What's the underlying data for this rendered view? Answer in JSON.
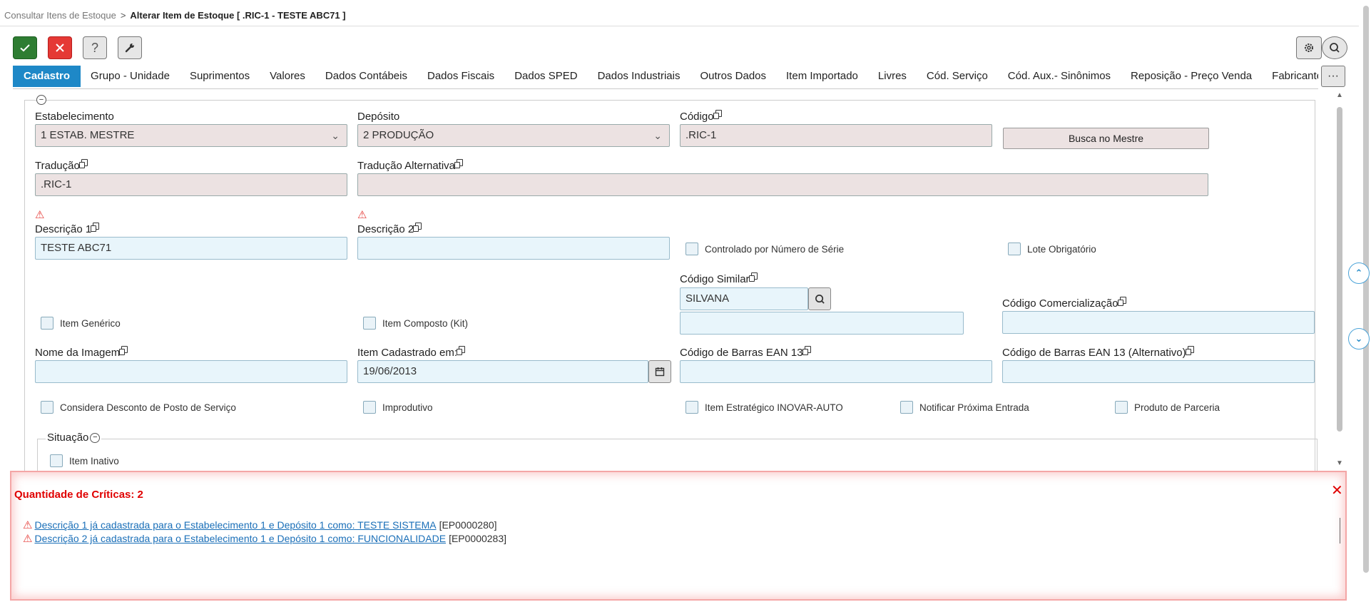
{
  "breadcrumb": {
    "parent": "Consultar Itens de Estoque",
    "separator": ">",
    "current": "Alterar Item de Estoque [ .RIC-1 - TESTE ABC71 ]"
  },
  "toolbar": {
    "ok_icon": "check-icon",
    "cancel_icon": "close-icon",
    "help_label": "?",
    "tool_icon": "wrench-icon",
    "settings_icon": "gear-icon",
    "search_icon": "search-icon"
  },
  "tabs": [
    {
      "label": "Cadastro",
      "active": true
    },
    {
      "label": "Grupo - Unidade"
    },
    {
      "label": "Suprimentos"
    },
    {
      "label": "Valores"
    },
    {
      "label": "Dados Contábeis"
    },
    {
      "label": "Dados Fiscais"
    },
    {
      "label": "Dados SPED"
    },
    {
      "label": "Dados Industriais"
    },
    {
      "label": "Outros Dados"
    },
    {
      "label": "Item Importado"
    },
    {
      "label": "Livres"
    },
    {
      "label": "Cód. Serviço"
    },
    {
      "label": "Cód. Aux.- Sinônimos"
    },
    {
      "label": "Reposição - Preço Venda"
    },
    {
      "label": "Fabricante X Referência"
    }
  ],
  "tabs_more_label": "···",
  "form": {
    "estabelecimento": {
      "label": "Estabelecimento",
      "value": "1 ESTAB. MESTRE"
    },
    "deposito": {
      "label": "Depósito",
      "value": "2 PRODUÇÃO"
    },
    "codigo": {
      "label": "Código",
      "value": ".RIC-1"
    },
    "busca_mestre": "Busca no Mestre",
    "traducao": {
      "label": "Tradução",
      "value": ".RIC-1"
    },
    "traducao_alt": {
      "label": "Tradução Alternativa",
      "value": ""
    },
    "descricao1": {
      "label": "Descrição 1",
      "value": "TESTE ABC71"
    },
    "descricao2": {
      "label": "Descrição 2",
      "value": ""
    },
    "controlado_serie": "Controlado por Número de Série",
    "lote_obrigatorio": "Lote Obrigatório",
    "codigo_similar": {
      "label": "Código Similar",
      "value": "SILVANA",
      "description": ""
    },
    "codigo_comercializacao": {
      "label": "Código Comercialização",
      "value": ""
    },
    "item_generico": "Item Genérico",
    "item_composto": "Item Composto (Kit)",
    "nome_imagem": {
      "label": "Nome da Imagem",
      "value": ""
    },
    "item_cadastrado": {
      "label": "Item Cadastrado em:",
      "value": "19/06/2013"
    },
    "ean13": {
      "label": "Código de Barras EAN 13",
      "value": ""
    },
    "ean13_alt": {
      "label": "Código de Barras EAN 13 (Alternativo)",
      "value": ""
    },
    "considera_desconto": "Considera Desconto de Posto de Serviço",
    "improdutivo": "Improdutivo",
    "item_estrategico": "Item Estratégico INOVAR-AUTO",
    "notificar_entrada": "Notificar Próxima Entrada",
    "produto_parceria": "Produto de Parceria",
    "situacao": {
      "legend": "Situação",
      "item_inativo": "Item Inativo"
    }
  },
  "errors": {
    "title": "Quantidade de Críticas: 2",
    "items": [
      {
        "text": "Descrição 1 já cadastrada para o Estabelecimento 1 e Depósito 1 como: TESTE SISTEMA",
        "code": "[EP0000280]"
      },
      {
        "text": "Descrição 2 já cadastrada para o Estabelecimento 1 e Depósito 1 como: FUNCIONALIDADE",
        "code": "[EP0000283]"
      }
    ]
  },
  "colors": {
    "primary": "#1e88c7",
    "ok": "#2e7d32",
    "cancel": "#e53935",
    "readonly_bg": "#ece2e2",
    "editable_bg": "#e8f5fb",
    "error": "#e00000"
  }
}
